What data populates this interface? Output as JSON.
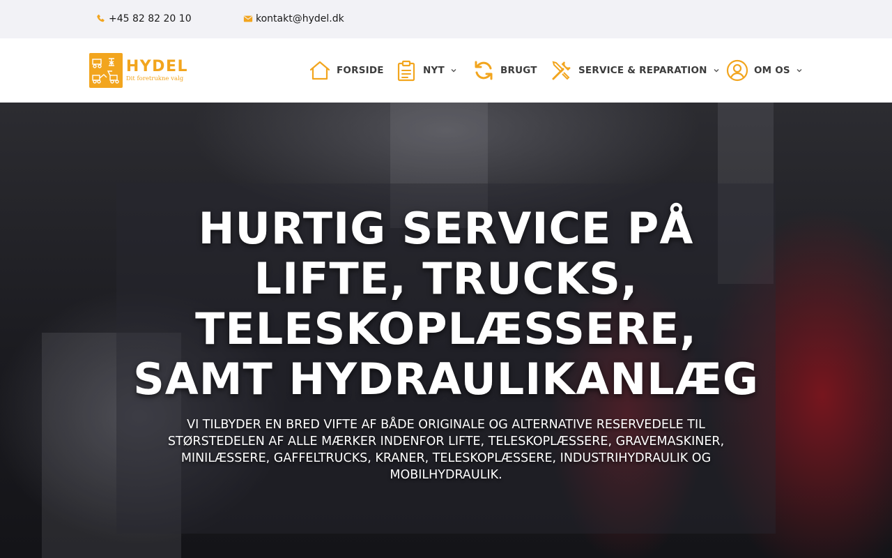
{
  "topbar": {
    "phone": "+45 82 82 20 10",
    "email": "kontakt@hydel.dk"
  },
  "logo": {
    "name": "HYDEL",
    "tagline": "Dit foretrukne valg"
  },
  "nav": {
    "items": [
      {
        "label": "FORSIDE",
        "icon": "home-icon",
        "has_dropdown": false
      },
      {
        "label": "NYT",
        "icon": "clipboard-icon",
        "has_dropdown": true
      },
      {
        "label": "BRUGT",
        "icon": "refresh-icon",
        "has_dropdown": false
      },
      {
        "label": "SERVICE & REPARATION",
        "icon": "tools-icon",
        "has_dropdown": true
      },
      {
        "label": "OM OS",
        "icon": "user-circle-icon",
        "has_dropdown": true
      }
    ]
  },
  "hero": {
    "title": "HURTIG SERVICE PÅ\nLIFTE, TRUCKS,\nTELESKOPLÆSSERE,\nSAMT HYDRAULIKANLÆG",
    "subtitle": "VI TILBYDER EN BRED VIFTE AF BÅDE ORIGINALE OG ALTERNATIVE RESERVEDELE TIL STØRSTEDELEN AF ALLE MÆRKER INDENFOR LIFTE, TELESKOPLÆSSERE, GRAVEMASKINER, MINILÆSSERE, GAFFELTRUCKS, KRANER, TELESKOPLÆSSERE, INDUSTRIHYDRAULIK OG MOBILHYDRAULIK."
  },
  "colors": {
    "accent": "#f2a51e",
    "topbar_bg": "#f2f2f6",
    "nav_text": "#3b3b3b"
  }
}
